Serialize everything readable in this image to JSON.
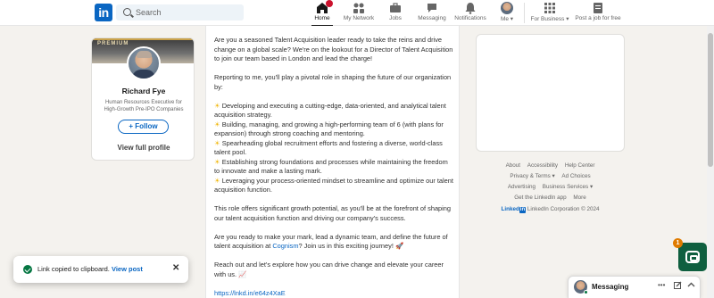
{
  "nav": {
    "logo": "in",
    "search_placeholder": "Search",
    "items": [
      {
        "label": "Home"
      },
      {
        "label": "My Network"
      },
      {
        "label": "Jobs"
      },
      {
        "label": "Messaging"
      },
      {
        "label": "Notifications"
      },
      {
        "label": "Me"
      },
      {
        "label": "For Business"
      },
      {
        "label": "Post a job for free"
      }
    ]
  },
  "profile": {
    "badge": "PREMIUM",
    "name": "Richard Fye",
    "headline": "Human Resources Executive for High-Growth Pre-IPO Companies",
    "follow_label": "+ Follow",
    "view_profile": "View full profile"
  },
  "post": {
    "intro": "Are you a seasoned Talent Acquisition leader ready to take the reins and drive change on a global scale? We're on the lookout for a Director of Talent Acquisition to join our team based in London and lead the charge!",
    "reporting": "Reporting to me, you'll play a pivotal role in shaping the future of our organization by:",
    "bullets": [
      "Developing and executing a cutting-edge, data-oriented, and analytical talent acquisition strategy.",
      "Building, managing, and growing a high-performing team of 6 (with plans for expansion) through strong coaching and mentoring.",
      "Spearheading global recruitment efforts and fostering a diverse, world-class talent pool.",
      "Establishing strong foundations and processes while maintaining the freedom to innovate and make a lasting mark.",
      "Leveraging your process-oriented mindset to streamline and optimize our talent acquisition function."
    ],
    "growth": "This role offers significant growth potential, as you'll be at the forefront of shaping our talent acquisition function and driving our company's success.",
    "cta_before": "Are you ready to make your mark, lead a dynamic team, and define the future of talent acquisition at ",
    "company": "Cognism",
    "cta_after": "? Join us in this exciting journey! 🚀",
    "reach_out": "Reach out and let's explore how you can drive change and elevate your career with us. 📈",
    "url": "https://lnkd.in/e64z4XaE"
  },
  "footer": {
    "row1": [
      "About",
      "Accessibility",
      "Help Center"
    ],
    "row2": [
      "Privacy & Terms ▾",
      "Ad Choices"
    ],
    "row3": [
      "Advertising",
      "Business Services ▾"
    ],
    "row4": [
      "Get the LinkedIn app",
      "More"
    ],
    "brand_text": "Linked",
    "brand_box": "in",
    "copyright": "LinkedIn Corporation © 2024"
  },
  "toast": {
    "message": "Link copied to clipboard.",
    "action": "View post"
  },
  "messaging": {
    "title": "Messaging"
  },
  "widget": {
    "badge": "1"
  },
  "colors": {
    "brand": "#0a66c2",
    "success": "#057642",
    "background": "#f4f2ee"
  }
}
